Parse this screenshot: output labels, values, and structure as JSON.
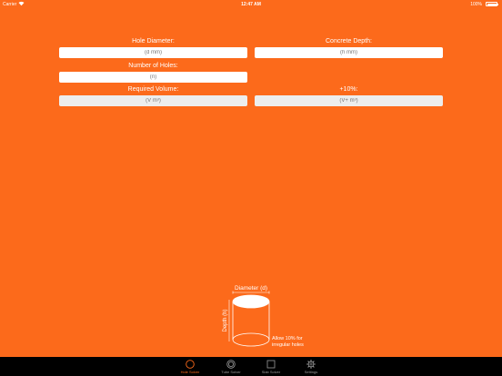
{
  "status_bar": {
    "carrier": "Carrier",
    "time": "12:47 AM",
    "battery": "100%"
  },
  "form": {
    "hole_diameter": {
      "label": "Hole Diameter:",
      "placeholder": "(d mm)"
    },
    "concrete_depth": {
      "label": "Concrete Depth:",
      "placeholder": "(h mm)"
    },
    "number_of_holes": {
      "label": "Number of Holes:",
      "placeholder": "(n)"
    },
    "required_volume": {
      "label": "Required Volume:",
      "placeholder": "(V m³)"
    },
    "plus_ten_percent": {
      "label": "+10%:",
      "placeholder": "(V+ m³)"
    }
  },
  "diagram": {
    "diameter_label": "Diameter (d)",
    "depth_label": "Depth (h)",
    "note_line1": "Allow 10% for",
    "note_line2": "irregular holes"
  },
  "tabs": [
    {
      "label": "Hole Solver",
      "icon": "circle-icon",
      "active": true
    },
    {
      "label": "Tube Solver",
      "icon": "concentric-circles-icon",
      "active": false
    },
    {
      "label": "Slab Solver",
      "icon": "square-icon",
      "active": false
    },
    {
      "label": "Settings",
      "icon": "gear-icon",
      "active": false
    }
  ],
  "colors": {
    "background": "#fc6a1b",
    "accent": "#fc6a1b",
    "tab_bar": "#000000",
    "tab_inactive": "#9a9a9a"
  }
}
